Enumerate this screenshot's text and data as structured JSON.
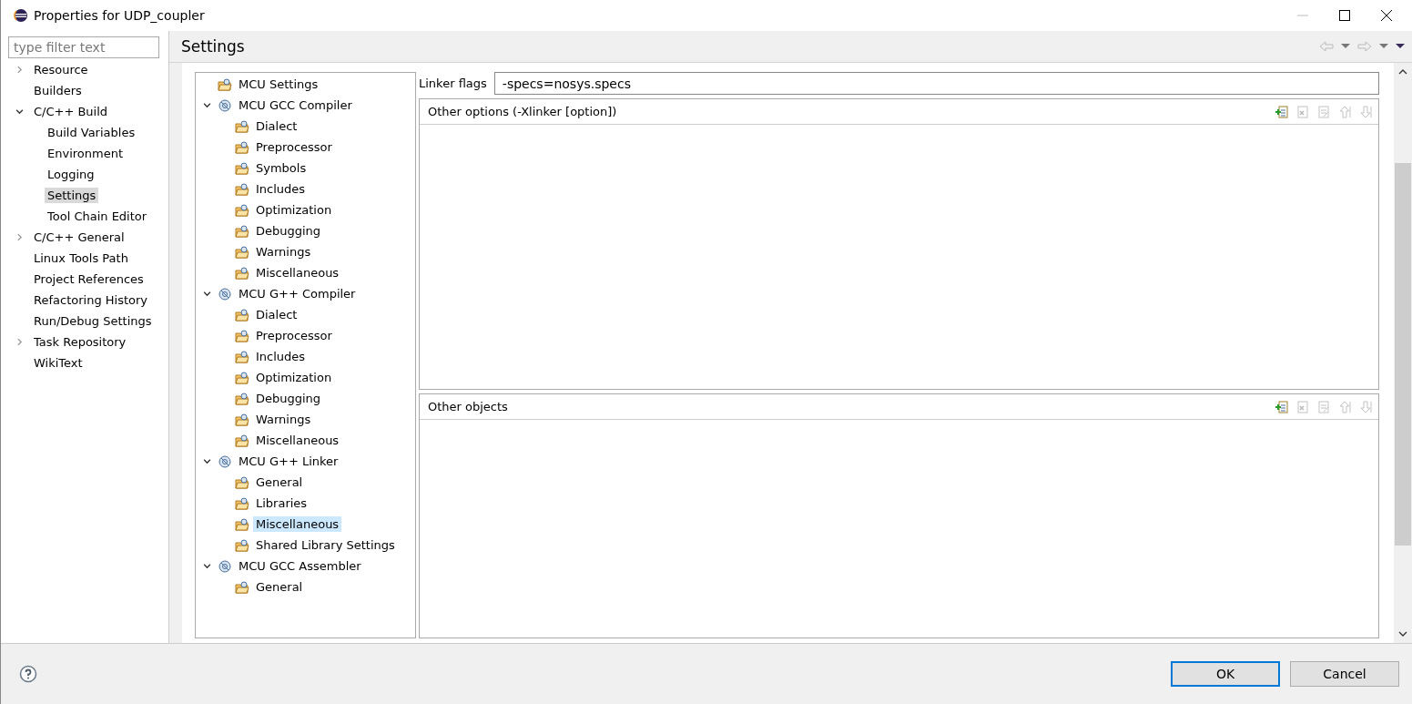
{
  "window": {
    "title": "Properties for UDP_coupler"
  },
  "filter": {
    "placeholder": "type filter text"
  },
  "nav": [
    {
      "label": "Resource",
      "expanded": false,
      "selected": false
    },
    {
      "label": "Builders",
      "selected": false
    },
    {
      "label": "C/C++ Build",
      "expanded": true,
      "selected": false,
      "children": [
        {
          "label": "Build Variables",
          "selected": false
        },
        {
          "label": "Environment",
          "selected": false
        },
        {
          "label": "Logging",
          "selected": false
        },
        {
          "label": "Settings",
          "selected": true
        },
        {
          "label": "Tool Chain Editor",
          "selected": false
        }
      ]
    },
    {
      "label": "C/C++ General",
      "expanded": false,
      "selected": false
    },
    {
      "label": "Linux Tools Path",
      "selected": false
    },
    {
      "label": "Project References",
      "selected": false
    },
    {
      "label": "Refactoring History",
      "selected": false
    },
    {
      "label": "Run/Debug Settings",
      "selected": false
    },
    {
      "label": "Task Repository",
      "expanded": false,
      "selected": false
    },
    {
      "label": "WikiText",
      "selected": false
    }
  ],
  "page_title": "Settings",
  "tools": [
    {
      "label": "MCU Settings",
      "kind": "option",
      "selected": false
    },
    {
      "label": "MCU GCC Compiler",
      "kind": "tool",
      "expanded": true,
      "selected": false,
      "children": [
        {
          "label": "Dialect",
          "selected": false
        },
        {
          "label": "Preprocessor",
          "selected": false
        },
        {
          "label": "Symbols",
          "selected": false
        },
        {
          "label": "Includes",
          "selected": false
        },
        {
          "label": "Optimization",
          "selected": false
        },
        {
          "label": "Debugging",
          "selected": false
        },
        {
          "label": "Warnings",
          "selected": false
        },
        {
          "label": "Miscellaneous",
          "selected": false
        }
      ]
    },
    {
      "label": "MCU G++ Compiler",
      "kind": "tool",
      "expanded": true,
      "selected": false,
      "children": [
        {
          "label": "Dialect",
          "selected": false
        },
        {
          "label": "Preprocessor",
          "selected": false
        },
        {
          "label": "Includes",
          "selected": false
        },
        {
          "label": "Optimization",
          "selected": false
        },
        {
          "label": "Debugging",
          "selected": false
        },
        {
          "label": "Warnings",
          "selected": false
        },
        {
          "label": "Miscellaneous",
          "selected": false
        }
      ]
    },
    {
      "label": "MCU G++ Linker",
      "kind": "tool",
      "expanded": true,
      "selected": false,
      "children": [
        {
          "label": "General",
          "selected": false
        },
        {
          "label": "Libraries",
          "selected": false
        },
        {
          "label": "Miscellaneous",
          "selected": true
        },
        {
          "label": "Shared Library Settings",
          "selected": false
        }
      ]
    },
    {
      "label": "MCU GCC Assembler",
      "kind": "tool",
      "expanded": true,
      "selected": false,
      "children": [
        {
          "label": "General",
          "selected": false
        }
      ]
    }
  ],
  "linker_flags": {
    "label": "Linker flags",
    "value": "-specs=nosys.specs"
  },
  "lists": [
    {
      "title": "Other options (-Xlinker [option])",
      "buttons": [
        {
          "disabled": false
        },
        {
          "disabled": true
        },
        {
          "disabled": true
        },
        {
          "disabled": true
        },
        {
          "disabled": true
        }
      ]
    },
    {
      "title": "Other objects",
      "buttons": [
        {
          "disabled": false
        },
        {
          "disabled": true
        },
        {
          "disabled": true
        },
        {
          "disabled": true
        },
        {
          "disabled": true
        }
      ]
    }
  ],
  "buttons": [
    {
      "label": "OK",
      "kind": "default"
    },
    {
      "label": "Cancel",
      "kind": "normal"
    }
  ]
}
